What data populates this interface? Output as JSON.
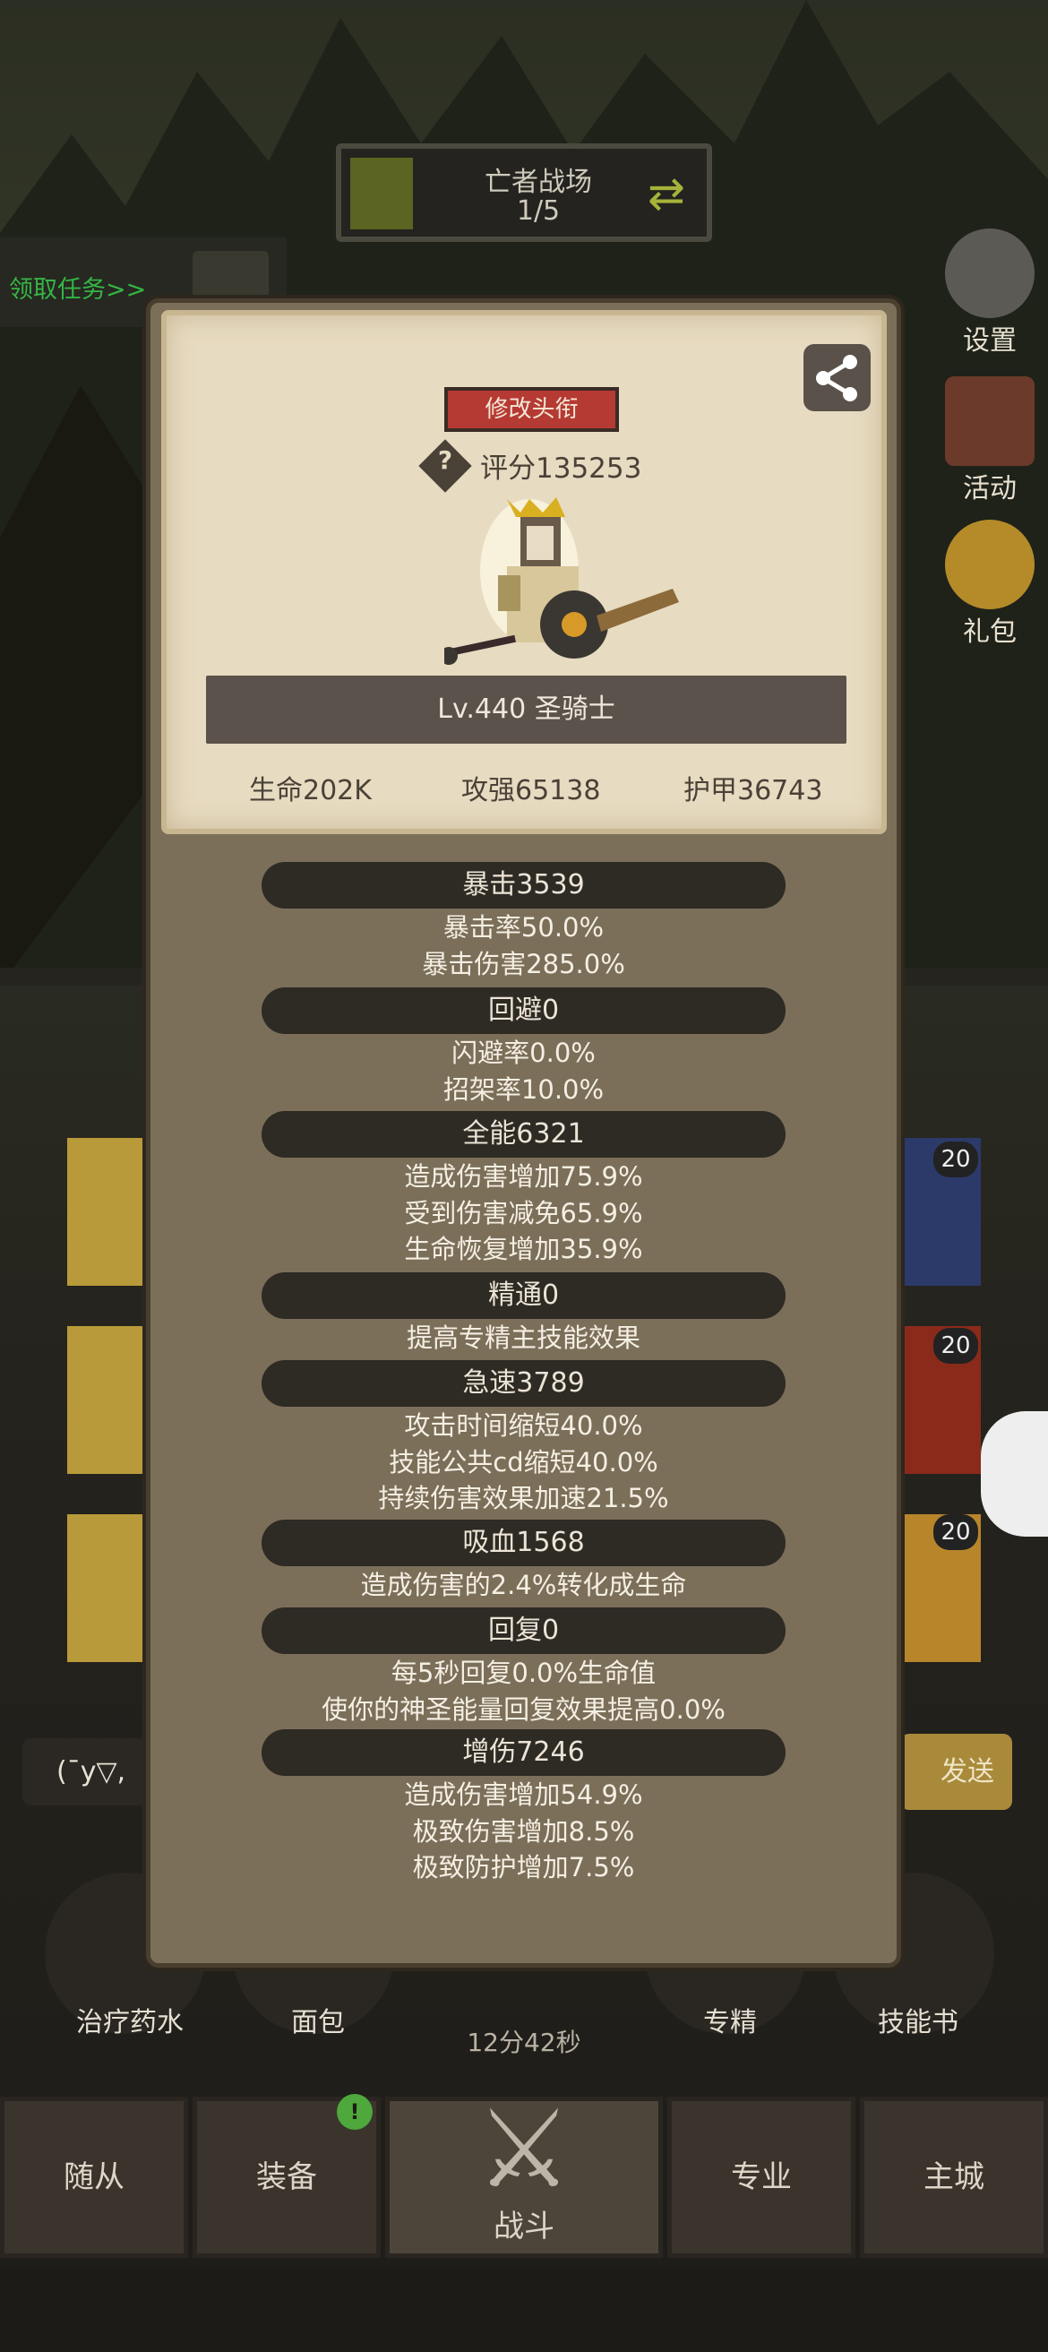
{
  "hud": {
    "battle_name": "亡者战场",
    "battle_progress": "1/5",
    "quest_label": "领取任务>>",
    "side_buttons": [
      {
        "label": "设置",
        "icon": "gear-icon"
      },
      {
        "label": "活动",
        "icon": "scroll-icon"
      },
      {
        "label": "礼包",
        "icon": "gift-icon"
      }
    ]
  },
  "card": {
    "rename_button": "修改头衔",
    "score_help": "?",
    "score": "评分135253",
    "level_class": "Lv.440 圣骑士",
    "stats": [
      "生命202K",
      "攻强65138",
      "护甲36743"
    ]
  },
  "attributes": [
    {
      "title": "暴击3539",
      "lines": [
        "暴击率50.0%",
        "暴击伤害285.0%"
      ]
    },
    {
      "title": "回避0",
      "lines": [
        "闪避率0.0%",
        "招架率10.0%"
      ]
    },
    {
      "title": "全能6321",
      "lines": [
        "造成伤害增加75.9%",
        "受到伤害减免65.9%",
        "生命恢复增加35.9%"
      ]
    },
    {
      "title": "精通0",
      "lines": [
        "提高专精主技能效果"
      ]
    },
    {
      "title": "急速3789",
      "lines": [
        "攻击时间缩短40.0%",
        "技能公共cd缩短40.0%",
        "持续伤害效果加速21.5%"
      ]
    },
    {
      "title": "吸血1568",
      "lines": [
        "造成伤害的2.4%转化成生命"
      ]
    },
    {
      "title": "回复0",
      "lines": [
        "每5秒回复0.0%生命值",
        "使你的神圣能量回复效果提高0.0%"
      ]
    },
    {
      "title": "增伤7246",
      "lines": [
        "造成伤害增加54.9%",
        "极致伤害增加8.5%",
        "极致防护增加7.5%"
      ]
    }
  ],
  "background": {
    "chat_input": "(¯y▽,",
    "send_fragment": "发送",
    "slot_levels": [
      "20",
      "20",
      "20"
    ],
    "items": [
      "治疗药水",
      "面包",
      "专精",
      "技能书"
    ],
    "timer": "12分42秒",
    "nav": [
      "随从",
      "装备",
      "战斗",
      "专业",
      "主城"
    ],
    "equip_badge": "!"
  },
  "colors": {
    "modal_bg": "#7b6f5a",
    "card_bg": "#e7dbc1",
    "pill_bg": "#2e2a24",
    "rename_red": "#b53a33"
  }
}
